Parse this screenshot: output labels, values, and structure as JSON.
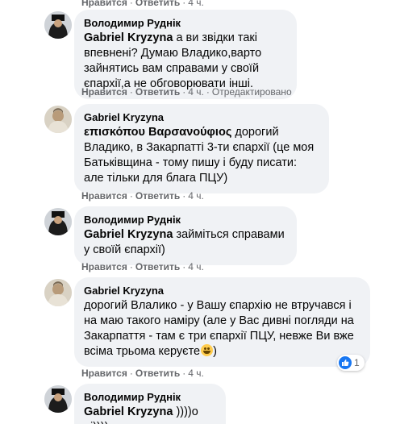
{
  "comments": [
    {
      "author": "",
      "mention": "",
      "text": "",
      "actions": {
        "like": "Нравится",
        "reply": "Ответить",
        "time": "4 ч."
      }
    },
    {
      "author": "Володимир Руднік",
      "mention": "Gabriel Kryzyna",
      "text": " а ви звідки такі впевнені? Думаю Владико,варто зайнятись вам справами у своїй єпархії,а не обговорювати інші.",
      "actions": {
        "like": "Нравится",
        "reply": "Ответить",
        "time": "4 ч.",
        "edited": "Отредактировано"
      }
    },
    {
      "author": "Gabriel Kryzyna",
      "mention": "επισκόπου Βαρσανούφιος",
      "text": " дорогий Владико, в Закарпатті 3-ти єпархії (це моя Батьківщина - тому пишу і буду писати: але тільки для блага ПЦУ)",
      "actions": {
        "like": "Нравится",
        "reply": "Ответить",
        "time": "4 ч."
      }
    },
    {
      "author": "Володимир Руднік",
      "mention": "Gabriel Kryzyna",
      "text": " займіться справами у своїй єпархії)",
      "actions": {
        "like": "Нравится",
        "reply": "Ответить",
        "time": "4 ч."
      }
    },
    {
      "author": "Gabriel Kryzyna",
      "mention": "",
      "text": "дорогий Влалико - у Вашу єпархію не втручався і на маю такого наміру (але у Вас дивні погляди на Закарпаття - там є три єпархії ПЦУ, невже Ви вже всіма трьома керуєте",
      "text_suffix": ")",
      "reactions_count": "1",
      "actions": {
        "like": "Нравится",
        "reply": "Ответить",
        "time": "4 ч."
      }
    },
    {
      "author": "Володимир Руднік",
      "mention": "Gabriel Kryzyna",
      "text": " ))))о ні))))",
      "actions": {
        "like": "",
        "reply": "",
        "time": ""
      }
    }
  ],
  "colors": {
    "bubble": "#f0f2f5",
    "text": "#050505",
    "secondary": "#65676b",
    "like_blue": "#1877f2"
  },
  "icons": {
    "like": "thumbs-up-icon",
    "emoji": "grinning-sweat-emoji"
  }
}
